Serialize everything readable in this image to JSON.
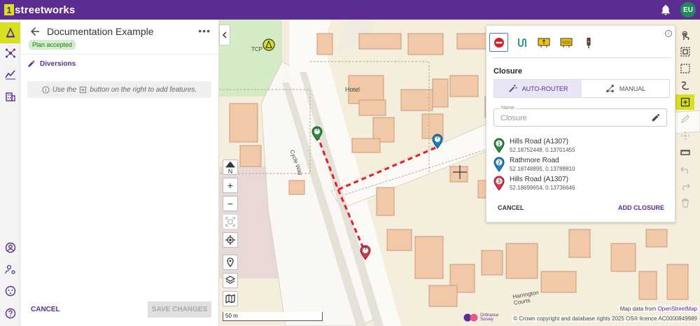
{
  "app": {
    "logo_number": "1",
    "logo_text": "streetworks",
    "user_initials": "EU"
  },
  "rail": {
    "items": [
      {
        "icon": "warning-cone-icon",
        "active": true
      },
      {
        "icon": "network-icon"
      },
      {
        "icon": "analytics-icon"
      },
      {
        "icon": "building-icon"
      },
      {
        "icon": "account-icon"
      },
      {
        "icon": "users-settings-icon"
      },
      {
        "icon": "support-icon"
      },
      {
        "icon": "help-icon"
      }
    ]
  },
  "panel": {
    "title": "Documentation Example",
    "status_badge": "Plan accepted",
    "section_label": "Diversions",
    "info_before": "Use the",
    "info_after": "button on the right to add features.",
    "cancel_label": "CANCEL",
    "save_label": "SAVE CHANGES"
  },
  "map": {
    "labels": {
      "hotel": "Hotel",
      "tcp": "TCP",
      "cycle_way": "Cycle Way",
      "harrington_courts": "Harrington Courts"
    },
    "compass": "N",
    "zoom_in": "+",
    "zoom_out": "−",
    "scale_label": "50 m",
    "attribution_prefix": "Map data from",
    "attribution_link": "OpenStreetMap",
    "copyright": "© Crown copyright and database rights 2025 OS® licence AC0000849989",
    "os_logo_line1": "Ordnance",
    "os_logo_line2": "Survey",
    "markers": [
      {
        "number": "1",
        "color": "#2e8b3e"
      },
      {
        "number": "2",
        "color": "#1c7fc4"
      },
      {
        "number": "3",
        "color": "#d0394a"
      }
    ],
    "route_color": "#e02030",
    "accent": "#d7e021"
  },
  "closure_card": {
    "title": "Closure",
    "mode_auto": "AUTO-ROUTER",
    "mode_manual": "MANUAL",
    "name_label": "Name",
    "name_value": "Closure",
    "waypoints": [
      {
        "number": "1",
        "name": "Hills Road (A1307)",
        "coords": "52.18752448, 0.13701455",
        "color": "#2e8b3e"
      },
      {
        "number": "2",
        "name": "Rathmore Road",
        "coords": "52.18748895, 0.13788810",
        "color": "#1c7fc4"
      },
      {
        "number": "3",
        "name": "Hills Road (A1307)",
        "coords": "52.18699654, 0.13736646",
        "color": "#d0394a"
      }
    ],
    "cancel_label": "CANCEL",
    "add_label": "ADD CLOSURE"
  }
}
